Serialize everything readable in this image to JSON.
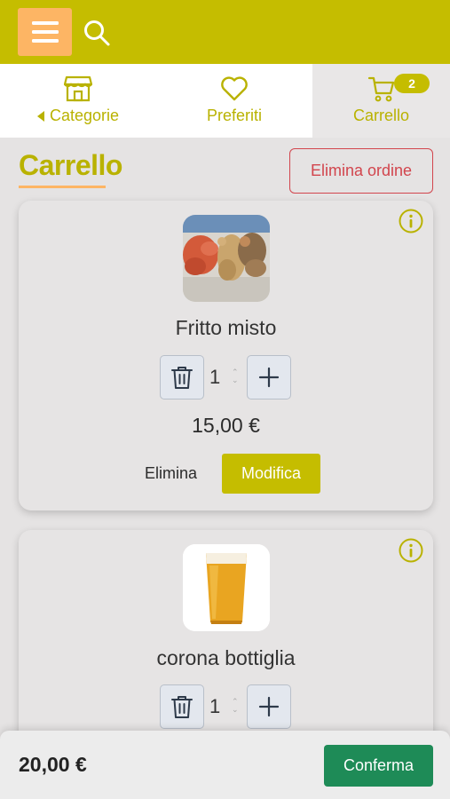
{
  "header": {
    "menu_icon": "hamburger-menu-icon",
    "search_icon": "search-icon",
    "brand_color": "#c5bd00",
    "menu_color": "#fdb564"
  },
  "nav": {
    "categories": {
      "label": "Categorie",
      "icon": "store-icon"
    },
    "favorites": {
      "label": "Preferiti",
      "icon": "heart-icon"
    },
    "cart": {
      "label": "Carrello",
      "icon": "cart-icon",
      "badge": "2"
    }
  },
  "page": {
    "title": "Carrello",
    "delete_order_label": "Elimina ordine"
  },
  "items": [
    {
      "name": "Fritto misto",
      "quantity": "1",
      "price": "15,00 €",
      "remove_label": "Elimina",
      "edit_label": "Modifica",
      "image": "fried-seafood-image"
    },
    {
      "name": "corona bottiglia",
      "quantity": "1",
      "image": "beer-glass-image"
    }
  ],
  "footer": {
    "total": "20,00 €",
    "confirm_label": "Conferma",
    "confirm_color": "#1e8b57"
  }
}
